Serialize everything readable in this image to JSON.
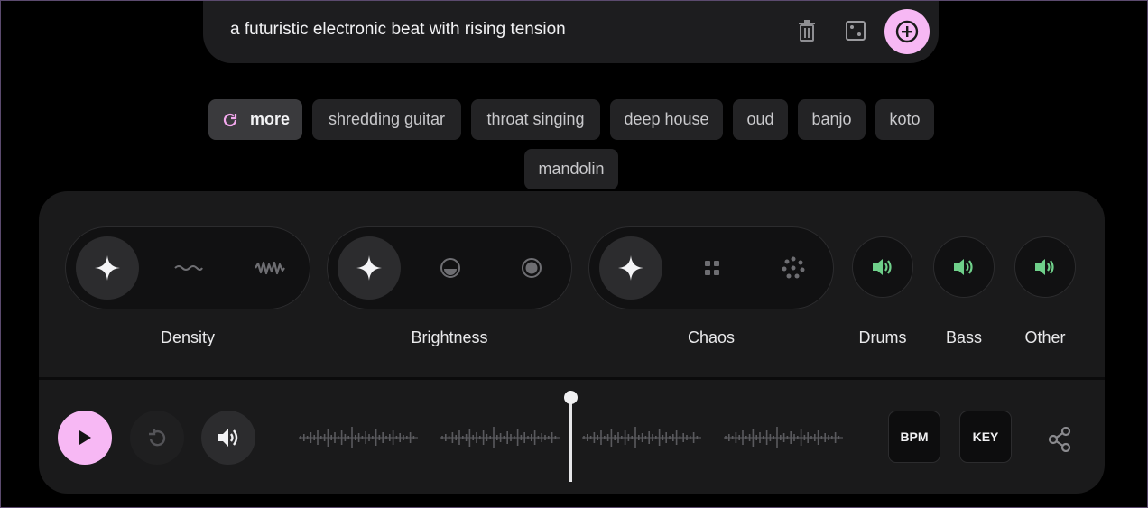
{
  "prompt": {
    "text": "a futuristic electronic beat with rising tension",
    "icons": [
      "trash-icon",
      "dice-icon",
      "add-circle-icon"
    ]
  },
  "chips": {
    "more_label": "more",
    "items": [
      "shredding guitar",
      "throat singing",
      "deep house",
      "oud",
      "banjo",
      "koto",
      "mandolin"
    ]
  },
  "controls": {
    "density": {
      "label": "Density",
      "selected": "auto"
    },
    "brightness": {
      "label": "Brightness",
      "selected": "auto"
    },
    "chaos": {
      "label": "Chaos",
      "selected": "auto"
    },
    "stems": [
      {
        "label": "Drums",
        "icon": "volume-icon",
        "color": "#6fd08a"
      },
      {
        "label": "Bass",
        "icon": "volume-icon",
        "color": "#6fd08a"
      },
      {
        "label": "Other",
        "icon": "volume-icon",
        "color": "#6fd08a"
      }
    ]
  },
  "transport": {
    "bpm_label": "BPM",
    "key_label": "KEY",
    "accent_color": "#f7b8f4"
  }
}
